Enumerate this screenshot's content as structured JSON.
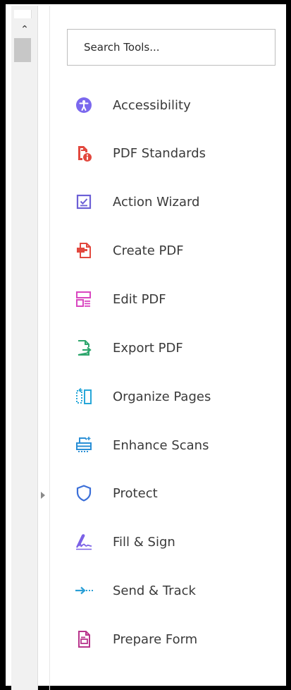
{
  "search": {
    "placeholder": "Search Tools..."
  },
  "tools": [
    {
      "label": "Accessibility",
      "icon": "accessibility-icon",
      "color": "#7b68ee"
    },
    {
      "label": "PDF Standards",
      "icon": "pdf-standards-icon",
      "color": "#e2483e"
    },
    {
      "label": "Action Wizard",
      "icon": "action-wizard-icon",
      "color": "#6c5fd6"
    },
    {
      "label": "Create PDF",
      "icon": "create-pdf-icon",
      "color": "#e2483e"
    },
    {
      "label": "Edit PDF",
      "icon": "edit-pdf-icon",
      "color": "#d946c0"
    },
    {
      "label": "Export PDF",
      "icon": "export-pdf-icon",
      "color": "#2ea66d"
    },
    {
      "label": "Organize Pages",
      "icon": "organize-pages-icon",
      "color": "#27a7d8"
    },
    {
      "label": "Enhance Scans",
      "icon": "enhance-scans-icon",
      "color": "#2a8fd6"
    },
    {
      "label": "Protect",
      "icon": "protect-icon",
      "color": "#3b6fd8"
    },
    {
      "label": "Fill & Sign",
      "icon": "fill-sign-icon",
      "color": "#7b61e6"
    },
    {
      "label": "Send & Track",
      "icon": "send-track-icon",
      "color": "#2a9fd6"
    },
    {
      "label": "Prepare Form",
      "icon": "prepare-form-icon",
      "color": "#b8348c"
    }
  ]
}
